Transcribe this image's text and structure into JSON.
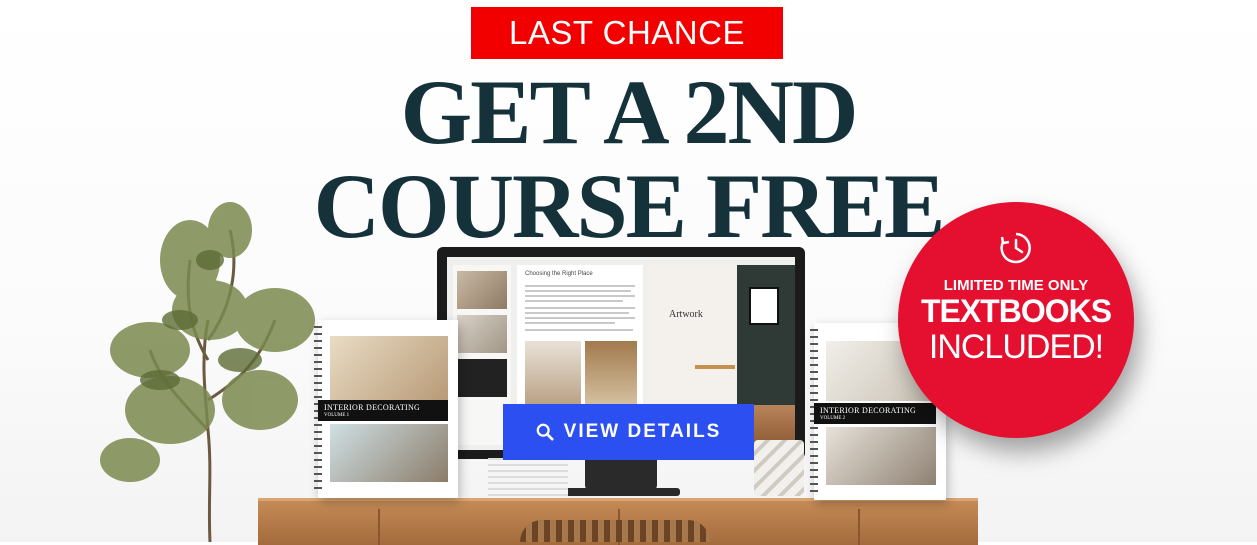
{
  "banner": {
    "badge_text": "LAST CHANCE",
    "headline_line1": "GET A 2ND",
    "headline_line2": "COURSE FREE",
    "cta_label": "VIEW DETAILS",
    "promo_line1": "LIMITED TIME ONLY",
    "promo_line2": "TEXTBOOKS",
    "promo_line3": "INCLUDED!"
  },
  "screen": {
    "heading": "Choosing the Right Place",
    "art_label": "Artwork"
  },
  "books": {
    "left_title": "INTERIOR DECORATING",
    "left_volume": "VOLUME 1",
    "right_title": "INTERIOR DECORATING",
    "right_volume": "VOLUME 2"
  },
  "colors": {
    "badge": "#f20000",
    "headline": "#15323a",
    "cta": "#2b4ff0",
    "promo_circle": "#e5102f"
  },
  "icons": {
    "cta_icon": "search-icon",
    "promo_icon": "clock-icon"
  }
}
